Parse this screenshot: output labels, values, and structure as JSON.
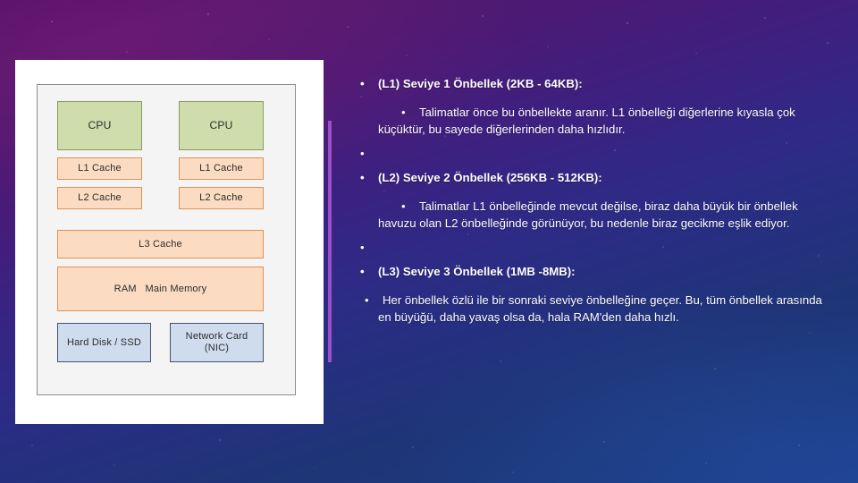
{
  "slide": {
    "background": {
      "top_color": "#4d1060",
      "bottom_color": "#1d4390",
      "accent_color": "#9b4fc4"
    }
  },
  "diagram": {
    "title": "cpu-cache-memory-hierarchy",
    "frame_background": "#f4f4f4",
    "colors": {
      "cpu_fill": "#cfdcab",
      "cpu_border": "#8a9c5c",
      "cache_fill": "#fbdcc2",
      "cache_border": "#e2914c",
      "io_fill": "#cfdced",
      "io_border": "#44536f"
    },
    "nodes": [
      {
        "id": "cpu-left",
        "label": "CPU",
        "kind": "cpu"
      },
      {
        "id": "cpu-right",
        "label": "CPU",
        "kind": "cpu"
      },
      {
        "id": "l1-cache-left",
        "label": "L1 Cache",
        "kind": "cache"
      },
      {
        "id": "l1-cache-right",
        "label": "L1 Cache",
        "kind": "cache"
      },
      {
        "id": "l2-cache-left",
        "label": "L2 Cache",
        "kind": "cache"
      },
      {
        "id": "l2-cache-right",
        "label": "L2 Cache",
        "kind": "cache"
      },
      {
        "id": "l3-cache",
        "label": "L3 Cache",
        "kind": "cache"
      },
      {
        "id": "ram",
        "label": "RAM   Main Memory",
        "kind": "cache"
      },
      {
        "id": "hard-disk",
        "label": "Hard Disk / SSD",
        "kind": "io"
      },
      {
        "id": "network-card",
        "label": "Network Card\n(NIC)",
        "kind": "io"
      }
    ]
  },
  "content": {
    "bullet_glyph": "•",
    "items": [
      {
        "id": "l1-heading",
        "style": "heading",
        "text": "(L1) Seviye 1 Önbellek (2KB - 64KB):"
      },
      {
        "id": "l1-body",
        "style": "body",
        "text": "Talimatlar önce bu önbellekte aranır. L1 önbelleği diğerlerine kıyasla çok küçüktür, bu sayede diğerlerinden daha hızlıdır."
      },
      {
        "id": "spacer-1",
        "style": "spacer",
        "text": ""
      },
      {
        "id": "l2-heading",
        "style": "heading",
        "text": "(L2) Seviye 2 Önbellek (256KB - 512KB):"
      },
      {
        "id": "l2-body",
        "style": "body",
        "text": "Talimatlar L1 önbelleğinde mevcut değilse, biraz daha büyük bir önbellek havuzu olan L2 önbelleğinde görünüyor, bu nedenle biraz gecikme eşlik ediyor."
      },
      {
        "id": "spacer-2",
        "style": "spacer",
        "text": ""
      },
      {
        "id": "l3-heading",
        "style": "heading",
        "text": "(L3) Seviye 3 Önbellek (1MB -8MB):"
      },
      {
        "id": "l3-body",
        "style": "body",
        "text": "Her önbellek özlü ile bir sonraki seviye önbelleğine geçer. Bu, tüm önbellek arasında en büyüğü, daha yavaş olsa da, hala RAM'den daha hızlı."
      }
    ]
  }
}
